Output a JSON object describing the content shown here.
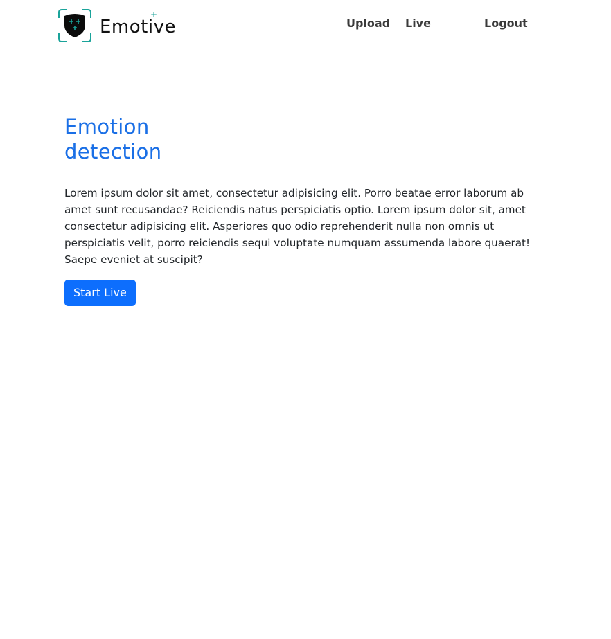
{
  "header": {
    "brand": {
      "name": "Emotive",
      "plus_glyph": "+",
      "icon": "shield-face-logo-icon",
      "colors": {
        "frame": "#1aa39a",
        "shield": "#0b0b0b",
        "sparkle": "#1aa39a"
      }
    },
    "nav": {
      "upload": "Upload",
      "live": "Live",
      "logout": "Logout"
    }
  },
  "hero": {
    "title": "Emotion detection",
    "text": "Lorem ipsum dolor sit amet, consectetur adipisicing elit. Porro beatae error laborum ab amet sunt recusandae? Reiciendis natus perspiciatis optio. Lorem ipsum dolor sit, amet consectetur adipisicing elit. Asperiores quo odio reprehenderit nulla non omnis ut perspiciatis velit, porro reiciendis sequi voluptate numquam assumenda labore quaerat! Saepe eveniet at suscipit?",
    "button_label": "Start Live"
  },
  "colors": {
    "accent": "#1a6fe6",
    "button": "#0d6efd",
    "nav_text": "#3a3a3a",
    "body_text": "#212529"
  }
}
